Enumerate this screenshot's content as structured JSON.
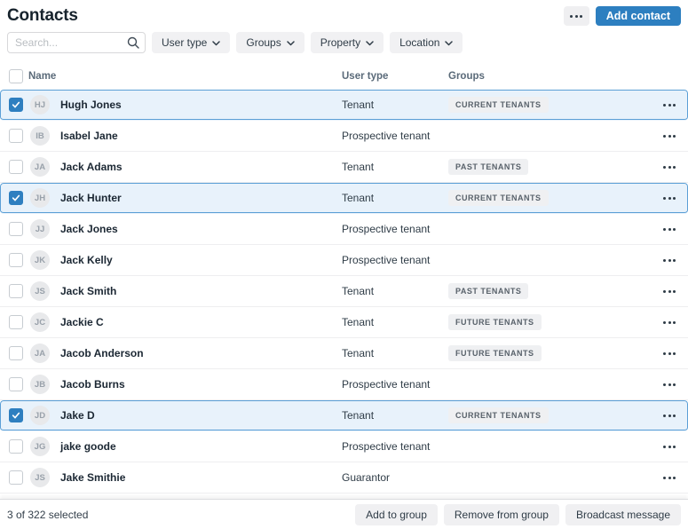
{
  "page": {
    "title": "Contacts"
  },
  "header": {
    "add_contact_label": "Add contact"
  },
  "filters": {
    "search_placeholder": "Search...",
    "buttons": [
      {
        "label": "User type"
      },
      {
        "label": "Groups"
      },
      {
        "label": "Property"
      },
      {
        "label": "Location"
      }
    ]
  },
  "table": {
    "columns": {
      "name": "Name",
      "user_type": "User type",
      "groups": "Groups"
    }
  },
  "rows": [
    {
      "initials": "HJ",
      "name": "Hugh Jones",
      "user_type": "Tenant",
      "group": "CURRENT TENANTS",
      "selected": true
    },
    {
      "initials": "IB",
      "name": "Isabel Jane",
      "user_type": "Prospective tenant",
      "group": "",
      "selected": false
    },
    {
      "initials": "JA",
      "name": "Jack Adams",
      "user_type": "Tenant",
      "group": "PAST TENANTS",
      "selected": false
    },
    {
      "initials": "JH",
      "name": "Jack Hunter",
      "user_type": "Tenant",
      "group": "CURRENT TENANTS",
      "selected": true
    },
    {
      "initials": "JJ",
      "name": "Jack Jones",
      "user_type": "Prospective tenant",
      "group": "",
      "selected": false
    },
    {
      "initials": "JK",
      "name": "Jack Kelly",
      "user_type": "Prospective tenant",
      "group": "",
      "selected": false
    },
    {
      "initials": "JS",
      "name": "Jack Smith",
      "user_type": "Tenant",
      "group": "PAST TENANTS",
      "selected": false
    },
    {
      "initials": "JC",
      "name": "Jackie C",
      "user_type": "Tenant",
      "group": "FUTURE TENANTS",
      "selected": false
    },
    {
      "initials": "JA",
      "name": "Jacob Anderson",
      "user_type": "Tenant",
      "group": "FUTURE TENANTS",
      "selected": false
    },
    {
      "initials": "JB",
      "name": "Jacob Burns",
      "user_type": "Prospective tenant",
      "group": "",
      "selected": false
    },
    {
      "initials": "JD",
      "name": "Jake D",
      "user_type": "Tenant",
      "group": "CURRENT TENANTS",
      "selected": true
    },
    {
      "initials": "JG",
      "name": "jake goode",
      "user_type": "Prospective tenant",
      "group": "",
      "selected": false
    },
    {
      "initials": "JS",
      "name": "Jake Smithie",
      "user_type": "Guarantor",
      "group": "",
      "selected": false
    }
  ],
  "footer": {
    "selection_summary": "3 of 322 selected",
    "buttons": [
      {
        "label": "Add to group"
      },
      {
        "label": "Remove from group"
      },
      {
        "label": "Broadcast message"
      }
    ]
  },
  "colors": {
    "accent_blue": "#2d7fc0",
    "selected_row_bg": "#e8f2fb",
    "selected_row_border": "#5b9fd6",
    "badge_bg": "#eff0f2",
    "filter_button_bg": "#f1f1f3"
  }
}
